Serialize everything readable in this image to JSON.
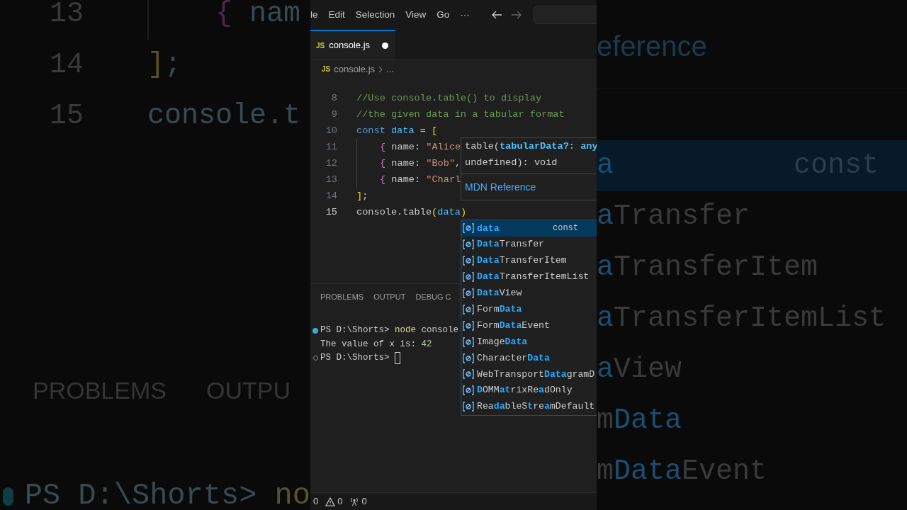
{
  "backdrop": {
    "left": {
      "code_lines": [
        {
          "number": "13",
          "indent": true,
          "tokens": [
            {
              "text": "{",
              "kind": "brace"
            },
            {
              "text": " nam",
              "kind": "plain"
            }
          ]
        },
        {
          "number": "14",
          "indent": false,
          "tokens": [
            {
              "text": "]",
              "kind": "bracket"
            },
            {
              "text": ";",
              "kind": "plain"
            }
          ]
        },
        {
          "number": "15",
          "indent": false,
          "tokens": [
            {
              "text": "console.t",
              "kind": "plain"
            }
          ]
        }
      ],
      "panel_tabs": [
        "PROBLEMS",
        "OUTPU"
      ],
      "terminal": [
        {
          "text": "PS D:\\Shorts> ",
          "kind": "plain"
        },
        {
          "text": "no",
          "kind": "command"
        }
      ]
    },
    "right": {
      "link": "eference",
      "items": [
        {
          "selected": true,
          "detail": "const",
          "parts": [
            {
              "text": "a",
              "match": true
            }
          ]
        },
        {
          "selected": false,
          "parts": [
            {
              "text": "a",
              "match": true
            },
            {
              "text": "Transfer",
              "match": false
            }
          ]
        },
        {
          "selected": false,
          "parts": [
            {
              "text": "a",
              "match": true
            },
            {
              "text": "TransferItem",
              "match": false
            }
          ]
        },
        {
          "selected": false,
          "parts": [
            {
              "text": "a",
              "match": true
            },
            {
              "text": "TransferItemList",
              "match": false
            }
          ]
        },
        {
          "selected": false,
          "parts": [
            {
              "text": "a",
              "match": true
            },
            {
              "text": "View",
              "match": false
            }
          ]
        },
        {
          "selected": false,
          "parts": [
            {
              "text": "m",
              "match": false
            },
            {
              "text": "Data",
              "match": true
            }
          ]
        },
        {
          "selected": false,
          "parts": [
            {
              "text": "m",
              "match": false
            },
            {
              "text": "Data",
              "match": true
            },
            {
              "text": "Event",
              "match": false
            }
          ]
        }
      ]
    }
  },
  "menu": [
    "le",
    "Edit",
    "Selection",
    "View",
    "Go",
    "···"
  ],
  "tab": {
    "icon_text": "JS",
    "label": "console.js",
    "modified": true
  },
  "breadcrumb": {
    "icon_text": "JS",
    "file": "console.js",
    "more": "..."
  },
  "code_lines": [
    {
      "number": "8",
      "active": false,
      "indent": false,
      "tokens": [
        {
          "text": "//Use console.table() to display",
          "kind": "comment"
        }
      ]
    },
    {
      "number": "9",
      "active": false,
      "indent": false,
      "tokens": [
        {
          "text": "//the given data in a tabular format",
          "kind": "comment"
        }
      ]
    },
    {
      "number": "10",
      "active": false,
      "indent": false,
      "tokens": [
        {
          "text": "const ",
          "kind": "keyword"
        },
        {
          "text": "data",
          "kind": "variable"
        },
        {
          "text": " = ",
          "kind": "plain"
        },
        {
          "text": "[",
          "kind": "bracket"
        }
      ]
    },
    {
      "number": "11",
      "active": false,
      "indent": true,
      "tokens": [
        {
          "text": "{",
          "kind": "brace"
        },
        {
          "text": " name: ",
          "kind": "plain"
        },
        {
          "text": "\"Alice",
          "kind": "string"
        }
      ]
    },
    {
      "number": "12",
      "active": false,
      "indent": true,
      "tokens": [
        {
          "text": "{",
          "kind": "brace"
        },
        {
          "text": " name: ",
          "kind": "plain"
        },
        {
          "text": "\"Bob\"",
          "kind": "string"
        },
        {
          "text": ",",
          "kind": "plain"
        }
      ]
    },
    {
      "number": "13",
      "active": false,
      "indent": true,
      "tokens": [
        {
          "text": "{",
          "kind": "brace"
        },
        {
          "text": " name: ",
          "kind": "plain"
        },
        {
          "text": "\"Charl",
          "kind": "string"
        }
      ]
    },
    {
      "number": "14",
      "active": false,
      "indent": false,
      "tokens": [
        {
          "text": "]",
          "kind": "bracket"
        },
        {
          "text": ";",
          "kind": "plain"
        }
      ]
    },
    {
      "number": "15",
      "active": true,
      "indent": false,
      "tokens": [
        {
          "text": "console.table",
          "kind": "plain"
        },
        {
          "text": "(",
          "kind": "bracket"
        },
        {
          "text": "data",
          "kind": "variable"
        },
        {
          "text": ")",
          "kind": "bracket"
        }
      ]
    }
  ],
  "hover": {
    "signature": [
      [
        {
          "text": "table(",
          "kind": "plain"
        },
        {
          "text": "tabularData?: any",
          "kind": "param"
        }
      ],
      [
        {
          "text": "undefined): void",
          "kind": "plain"
        }
      ]
    ],
    "link": "MDN Reference"
  },
  "suggestions": [
    {
      "selected": true,
      "detail": "const",
      "parts": [
        {
          "text": "data",
          "match": true
        }
      ]
    },
    {
      "selected": false,
      "parts": [
        {
          "text": "Data",
          "match": true
        },
        {
          "text": "Transfer",
          "match": false
        }
      ]
    },
    {
      "selected": false,
      "parts": [
        {
          "text": "Data",
          "match": true
        },
        {
          "text": "TransferItem",
          "match": false
        }
      ]
    },
    {
      "selected": false,
      "parts": [
        {
          "text": "Data",
          "match": true
        },
        {
          "text": "TransferItemList",
          "match": false
        }
      ]
    },
    {
      "selected": false,
      "parts": [
        {
          "text": "Data",
          "match": true
        },
        {
          "text": "View",
          "match": false
        }
      ]
    },
    {
      "selected": false,
      "parts": [
        {
          "text": "Form",
          "match": false
        },
        {
          "text": "Data",
          "match": true
        }
      ]
    },
    {
      "selected": false,
      "parts": [
        {
          "text": "Form",
          "match": false
        },
        {
          "text": "Data",
          "match": true
        },
        {
          "text": "Event",
          "match": false
        }
      ]
    },
    {
      "selected": false,
      "parts": [
        {
          "text": "Image",
          "match": false
        },
        {
          "text": "Data",
          "match": true
        }
      ]
    },
    {
      "selected": false,
      "parts": [
        {
          "text": "Character",
          "match": false
        },
        {
          "text": "Data",
          "match": true
        }
      ]
    },
    {
      "selected": false,
      "parts": [
        {
          "text": "WebTransport",
          "match": false
        },
        {
          "text": "Data",
          "match": true
        },
        {
          "text": "gramD",
          "match": false
        }
      ]
    },
    {
      "selected": false,
      "parts": [
        {
          "text": "D",
          "match": true
        },
        {
          "text": "OMM",
          "match": false
        },
        {
          "text": "at",
          "match": true
        },
        {
          "text": "rixRe",
          "match": false
        },
        {
          "text": "a",
          "match": true
        },
        {
          "text": "dOnly",
          "match": false
        }
      ]
    },
    {
      "selected": false,
      "parts": [
        {
          "text": "Rea",
          "match": false
        },
        {
          "text": "da",
          "match": true
        },
        {
          "text": "bleS",
          "match": false
        },
        {
          "text": "t",
          "match": true
        },
        {
          "text": "re",
          "match": false
        },
        {
          "text": "a",
          "match": true
        },
        {
          "text": "mDefault",
          "match": false
        }
      ]
    }
  ],
  "panel_tabs": [
    {
      "label": "PROBLEMS",
      "selected": false
    },
    {
      "label": "OUTPUT",
      "selected": false
    },
    {
      "label": "DEBUG C",
      "selected": false
    }
  ],
  "terminal": [
    {
      "kind": "success",
      "cursor": false,
      "tokens": [
        {
          "text": "PS D:\\Shorts> ",
          "kind": "plain"
        },
        {
          "text": "node",
          "kind": "command"
        },
        {
          "text": " console",
          "kind": "plain"
        }
      ]
    },
    {
      "kind": "output",
      "cursor": false,
      "tokens": [
        {
          "text": "The value of x is: ",
          "kind": "plain"
        },
        {
          "text": "42",
          "kind": "number"
        }
      ]
    },
    {
      "kind": "idle",
      "cursor": true,
      "tokens": [
        {
          "text": "PS D:\\Shorts> ",
          "kind": "plain"
        }
      ]
    }
  ],
  "status": [
    {
      "kind": "errors",
      "count": "0"
    },
    {
      "kind": "warnings",
      "count": "0"
    },
    {
      "kind": "ports",
      "count": "0"
    }
  ]
}
